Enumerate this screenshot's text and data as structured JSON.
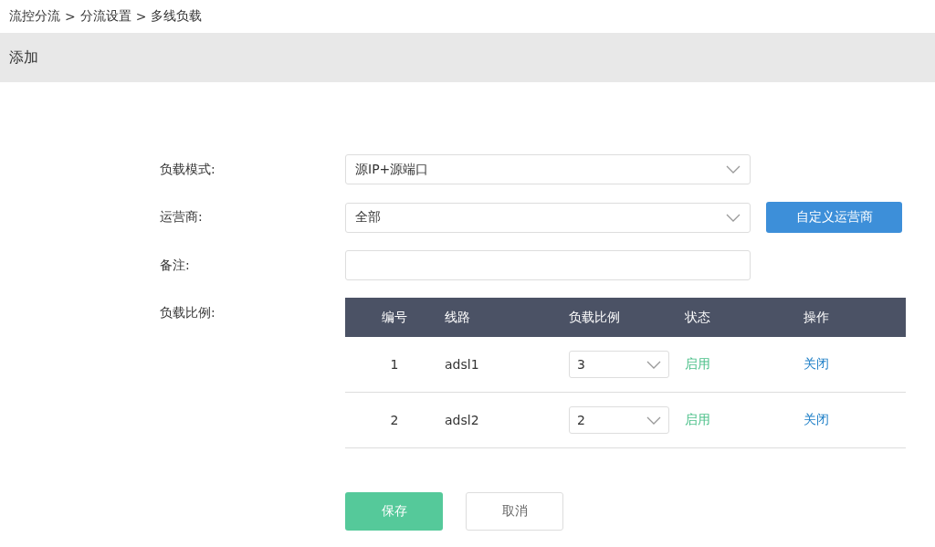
{
  "breadcrumb": [
    "流控分流",
    ">",
    "分流设置",
    ">",
    "多线负载"
  ],
  "panel": {
    "title": "添加"
  },
  "form": {
    "mode": {
      "label": "负载模式:",
      "value": "源IP+源端口"
    },
    "carrier": {
      "label": "运营商:",
      "value": "全部",
      "button": "自定义运营商"
    },
    "note": {
      "label": "备注:"
    },
    "ratio": {
      "label": "负载比例:"
    }
  },
  "table": {
    "columns": [
      "编号",
      "线路",
      "负载比例",
      "状态",
      "操作"
    ],
    "rows": [
      {
        "id": "1",
        "line": "adsl1",
        "ratio": "3",
        "status": "启用",
        "action": "关闭"
      },
      {
        "id": "2",
        "line": "adsl2",
        "ratio": "2",
        "status": "启用",
        "action": "关闭"
      }
    ]
  },
  "buttons": {
    "save": "保存",
    "cancel": "取消"
  }
}
